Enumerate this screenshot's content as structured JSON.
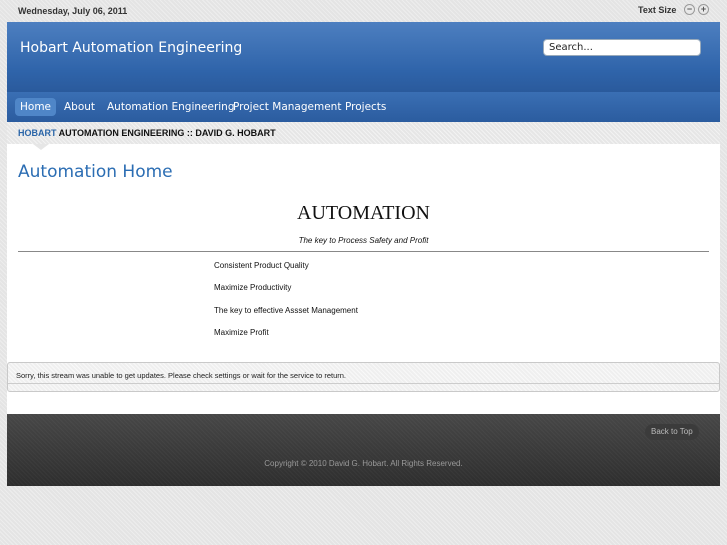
{
  "topbar": {
    "date": "Wednesday, July 06, 2011",
    "text_size_label": "Text Size",
    "decrease_icon": "−",
    "increase_icon": "+"
  },
  "header": {
    "site_title": "Hobart Automation Engineering",
    "search_value": "Search..."
  },
  "nav": {
    "items": [
      {
        "label": "Home"
      },
      {
        "label": "About"
      },
      {
        "label": "Automation Engineering"
      },
      {
        "label": "Project Management"
      },
      {
        "label": "Projects"
      }
    ]
  },
  "breadcrumb": {
    "highlight": "HOBART",
    "rest": " AUTOMATION ENGINEERING :: DAVID G. HOBART"
  },
  "main": {
    "page_title": "Automation Home",
    "heading": "AUTOMATION",
    "tagline": "The key to Process Safety and Profit",
    "bullets": [
      "Consistent Product Quality",
      "Maximize Productivity",
      "The key to effective Assset Management",
      "Maximize Profit"
    ]
  },
  "notice": {
    "message": "Sorry, this stream was unable to get updates. Please check settings or wait for the service to return."
  },
  "footer": {
    "back_to_top": "Back to Top",
    "copyright": "Copyright © 2010 David G. Hobart. All Rights Reserved."
  },
  "colors": {
    "header_blue": "#2f64aa",
    "title_blue": "#2b6db3",
    "footer_dark": "#3a3a3a"
  }
}
